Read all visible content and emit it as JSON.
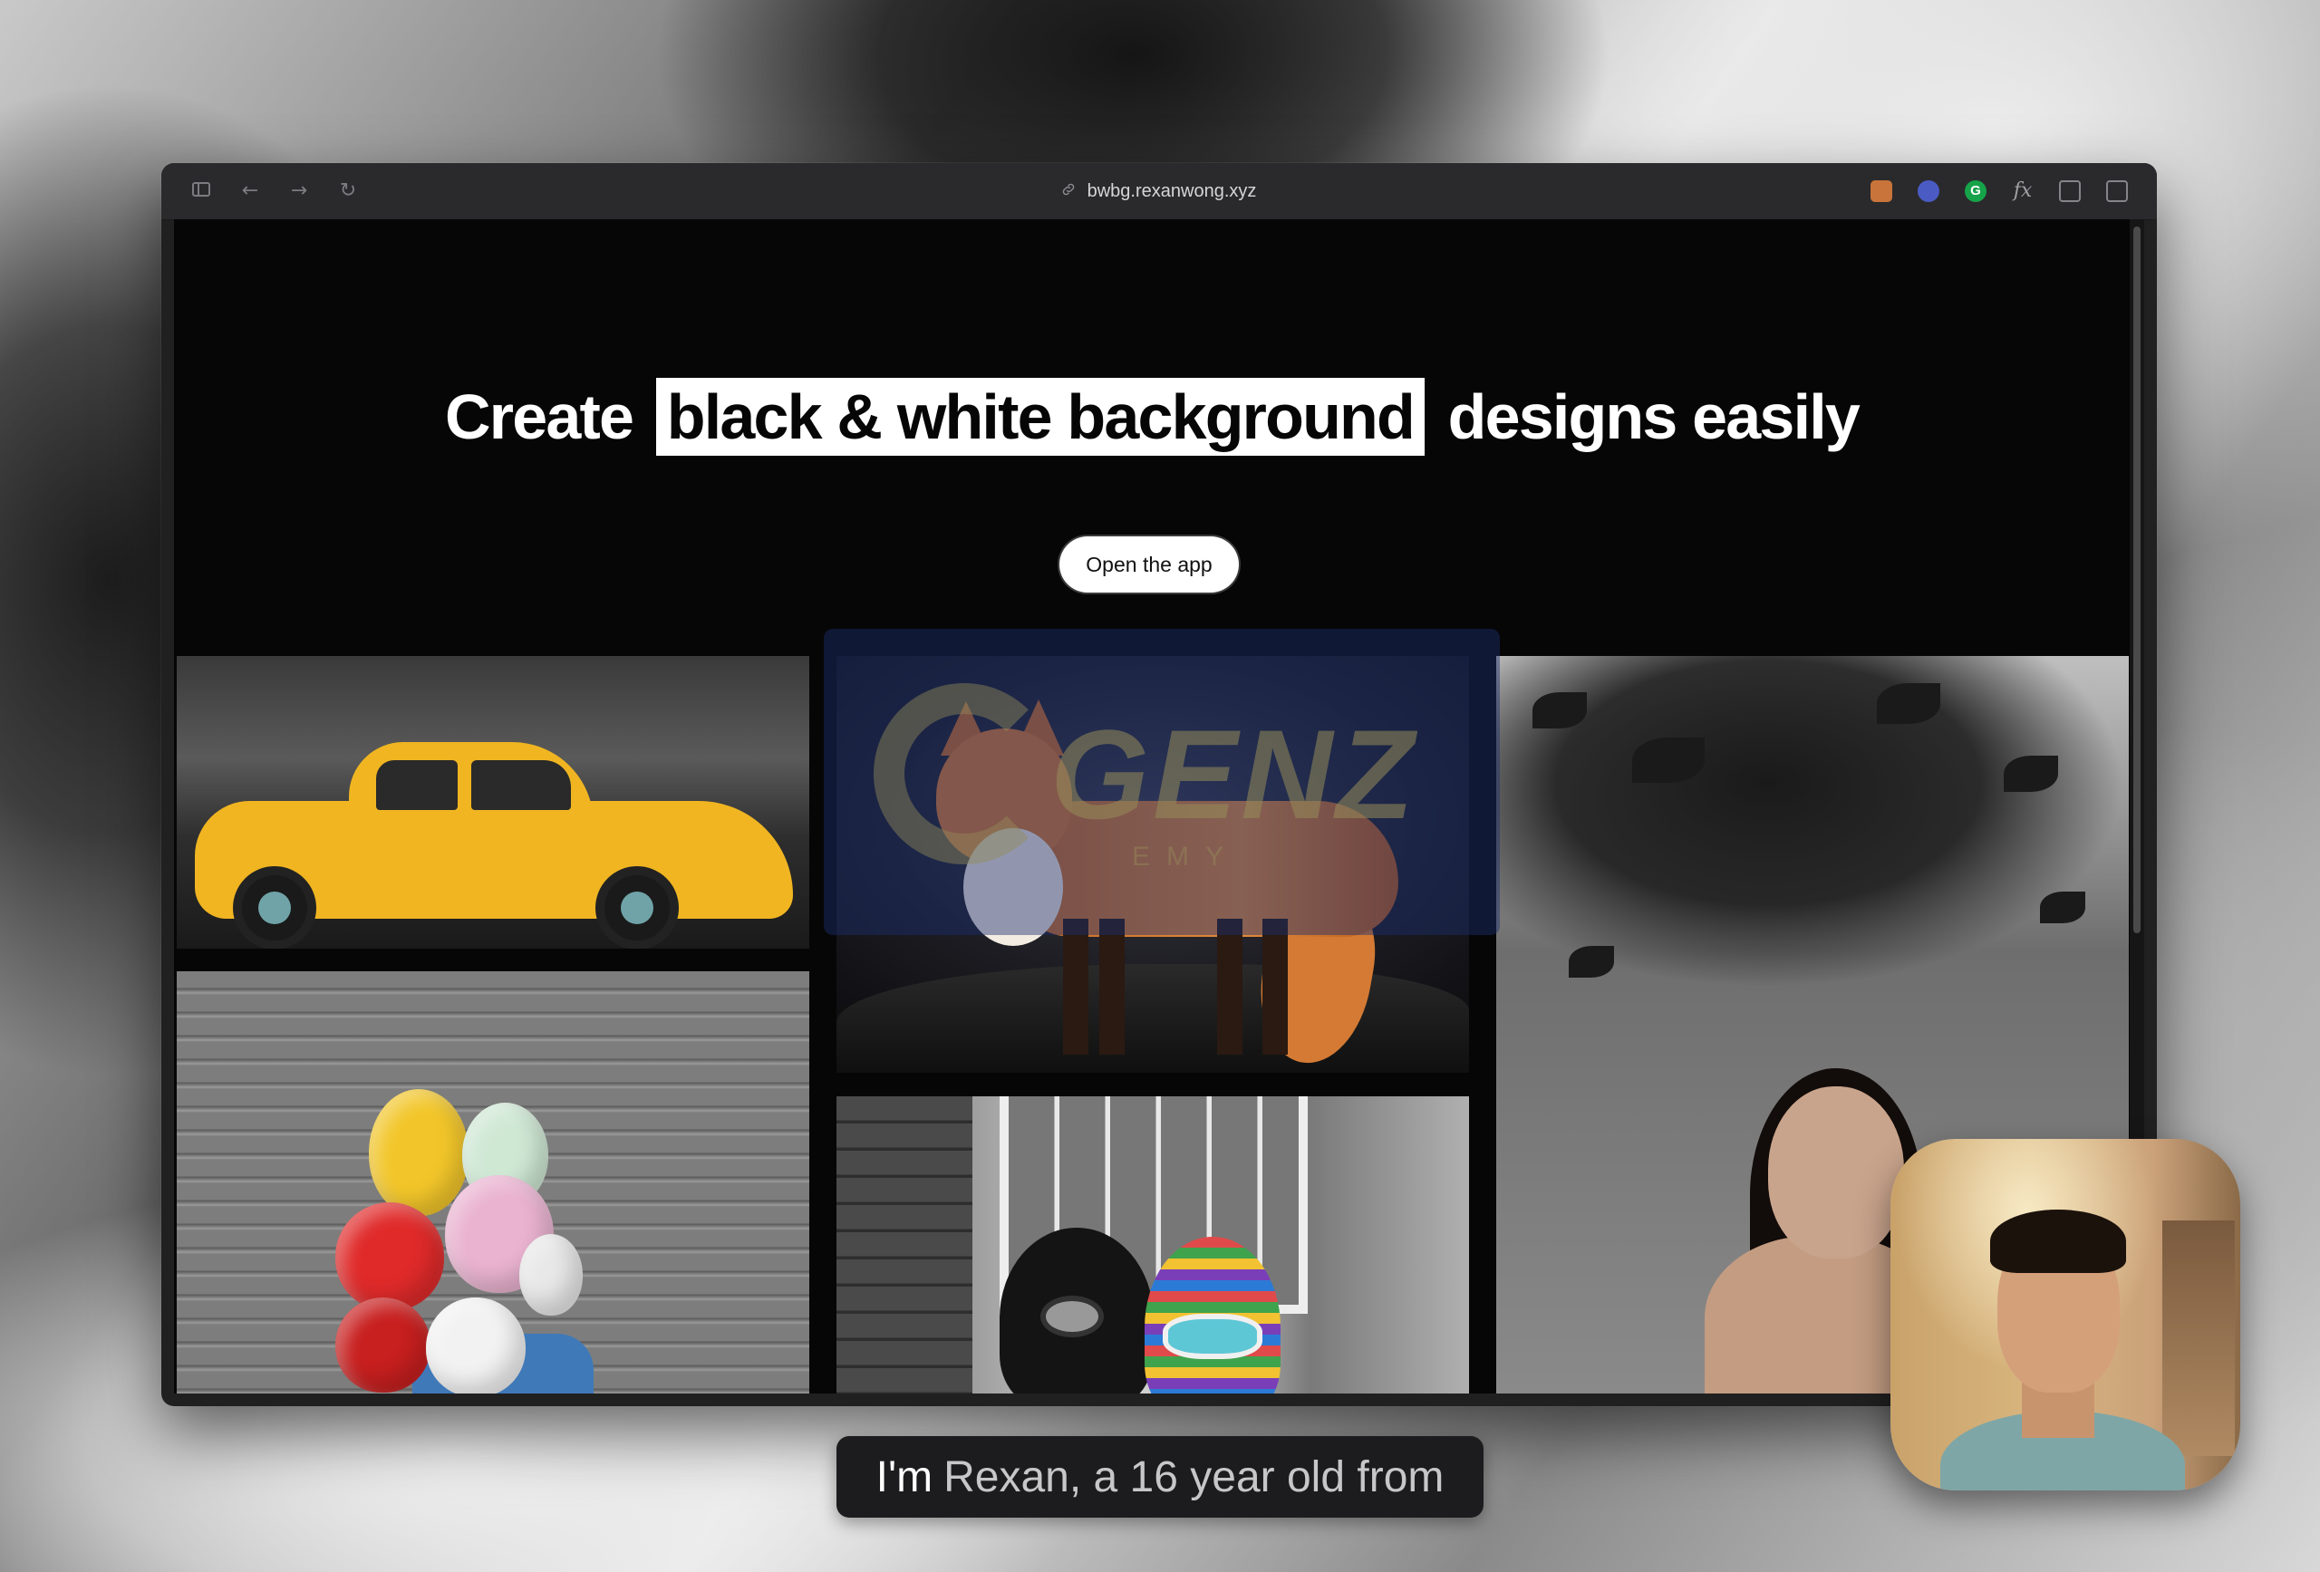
{
  "browser": {
    "url": "bwbg.rexanwong.xyz",
    "toolbar_icons": [
      "sidebar-icon",
      "back-arrow-icon",
      "forward-arrow-icon",
      "reload-icon"
    ],
    "extension_icons": [
      "fox-extension-icon",
      "blue-extension-icon",
      "grammarly-icon",
      "function-icon",
      "reader-icon",
      "split-view-icon"
    ],
    "extension_labels": {
      "grammarly": "G",
      "function": "fx"
    }
  },
  "hero": {
    "title_before": "Create",
    "title_highlight": "black & white background",
    "title_after": "designs easily",
    "cta_label": "Open the app"
  },
  "gallery": {
    "images": [
      "yellow-car-photo",
      "fox-photo",
      "tree-portrait-photo",
      "balloons-photo",
      "ski-masks-photo"
    ],
    "watermark_text": "GENZ",
    "watermark_subtext": "EMY"
  },
  "caption": {
    "spoken": "I'm",
    "upcoming": "Rexan, a 16 year old from"
  },
  "colors": {
    "page_bg": "#060606",
    "highlight_bg": "#ffffff",
    "cta_bg": "#ffffff",
    "titlebar": "#2a2a2c",
    "car_yellow": "#f0b521",
    "fox_orange": "#d9782f"
  }
}
